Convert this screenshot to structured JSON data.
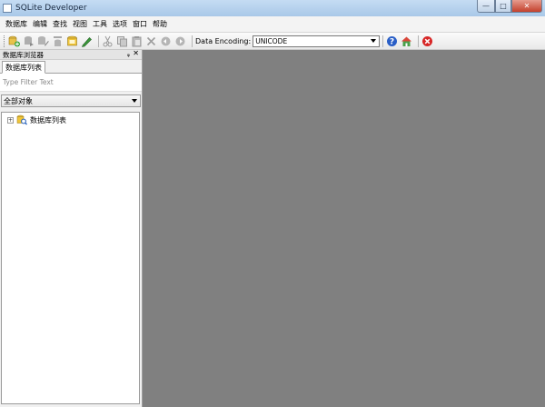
{
  "window": {
    "title": "SQLite Developer"
  },
  "menu": [
    "数据库",
    "编辑",
    "查找",
    "视图",
    "工具",
    "选项",
    "窗口",
    "帮助"
  ],
  "toolbar": {
    "encoding_label": "Data Encoding:",
    "encoding_value": "UNICODE"
  },
  "panel": {
    "title": "数据库浏览器",
    "tab": "数据库列表",
    "filter_placeholder": "Type Filter Text",
    "object_filter": "全部对象",
    "tree_root": "数据库列表"
  }
}
